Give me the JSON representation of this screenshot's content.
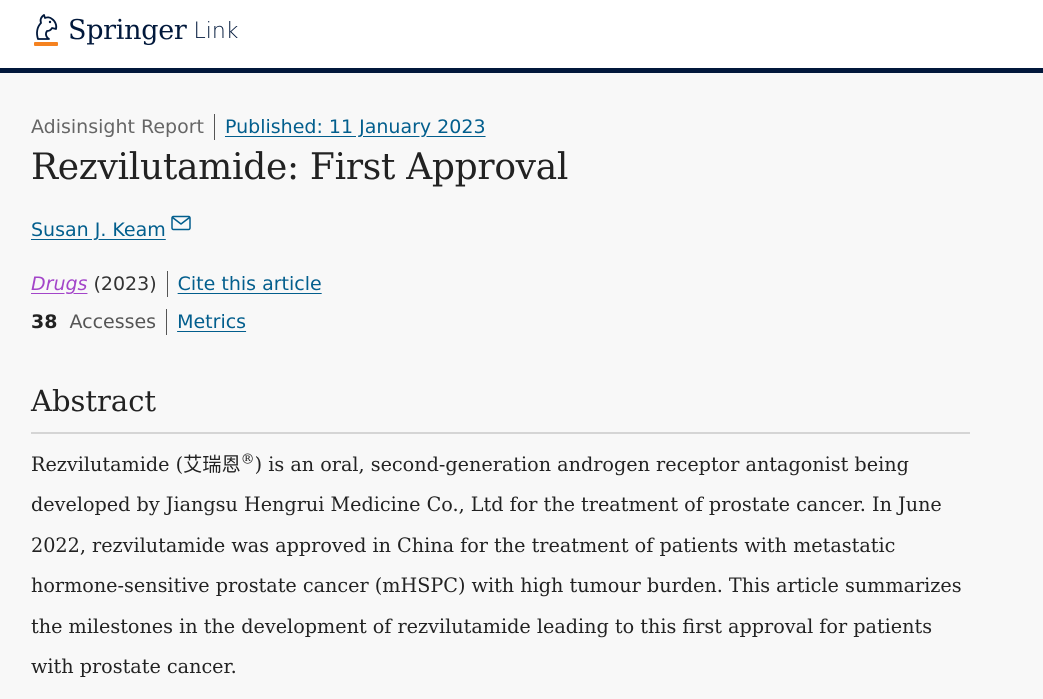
{
  "header": {
    "brand_main": "Springer",
    "brand_sub": "Link",
    "brand_color": "#01183b"
  },
  "article": {
    "type": "Adisinsight Report",
    "published": "Published: 11 January 2023",
    "title": "Rezvilutamide: First Approval",
    "author": "Susan J. Keam",
    "author_icon": "mail-icon",
    "journal": "Drugs",
    "year": "(2023)",
    "cite_label": "Cite this article",
    "accesses_count": "38",
    "accesses_label": "Accesses",
    "metrics_label": "Metrics"
  },
  "abstract": {
    "heading": "Abstract",
    "text_before_mark": "Rezvilutamide (艾瑞恩",
    "registered_mark": "®",
    "text_after_mark": ") is an oral, second-generation androgen receptor antagonist being developed by Jiangsu Hengrui Medicine Co., Ltd for the treatment of prostate cancer. In June 2022, rezvilutamide was approved in China for the treatment of patients with metastatic hormone-sensitive prostate cancer (mHSPC) with high tumour burden. This article summarizes the milestones in the development of rezvilutamide leading to this first approval for patients with prostate cancer."
  },
  "colors": {
    "link": "#025e8d",
    "journal_link": "#a345c9",
    "header_rule": "#01183b",
    "logo_accent": "#f58220"
  }
}
